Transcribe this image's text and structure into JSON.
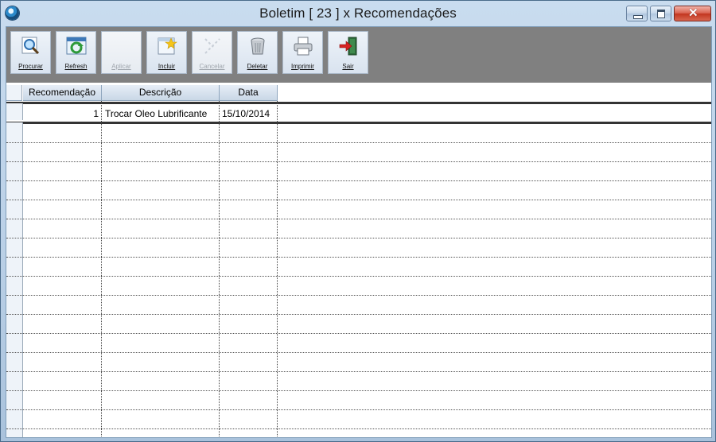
{
  "window": {
    "title": "Boletim [ 23 ] x Recomendações"
  },
  "toolbar": {
    "buttons": [
      {
        "label": "Procurar",
        "icon": "magnifier-icon",
        "enabled": true
      },
      {
        "label": "Refresh",
        "icon": "refresh-icon",
        "enabled": true
      },
      {
        "label": "Aplicar",
        "icon": "apply-icon",
        "enabled": false
      },
      {
        "label": "Incluir",
        "icon": "new-document-icon",
        "enabled": true
      },
      {
        "label": "Cancelar",
        "icon": "cancel-icon",
        "enabled": false
      },
      {
        "label": "Deletar",
        "icon": "trash-icon",
        "enabled": true
      },
      {
        "label": "Imprimir",
        "icon": "printer-icon",
        "enabled": true
      },
      {
        "label": "Sair",
        "icon": "exit-door-icon",
        "enabled": true
      }
    ]
  },
  "grid": {
    "columns": [
      "Recomendação",
      "Descrição",
      "Data"
    ],
    "rows": [
      {
        "recomendacao": "1",
        "descricao": "Trocar Oleo Lubrificante",
        "data": "15/10/2014"
      }
    ]
  },
  "colors": {
    "toolbar_bg": "#808080",
    "title_bar": "#b9cfe6",
    "close_button": "#c2361f"
  }
}
